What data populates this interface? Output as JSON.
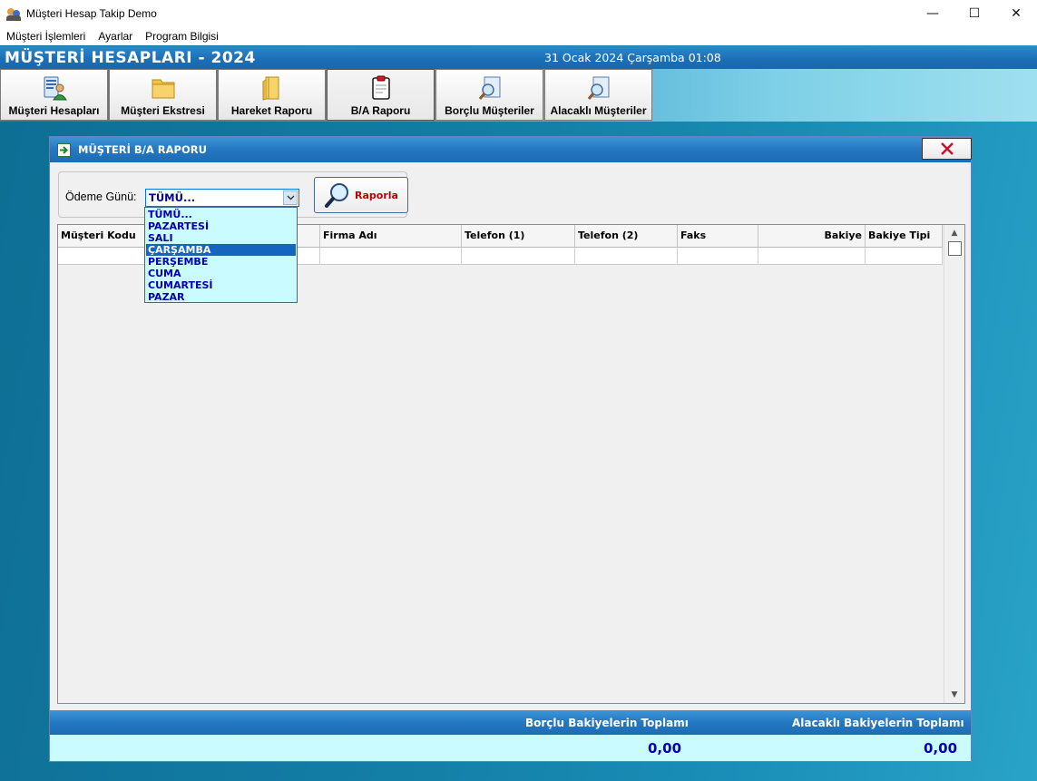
{
  "window": {
    "title": "Müşteri Hesap Takip Demo",
    "minimize_glyph": "—",
    "maximize_glyph": "☐",
    "close_glyph": "✕"
  },
  "menu": {
    "items": [
      "Müşteri İşlemleri",
      "Ayarlar",
      "Program Bilgisi"
    ]
  },
  "header": {
    "title": "MÜŞTERİ HESAPLARI - 2024",
    "date": "31 Ocak 2024 Çarşamba 01:08"
  },
  "toolbar": {
    "buttons": [
      {
        "label": "Müşteri Hesapları",
        "icon": "customer-accounts-icon"
      },
      {
        "label": "Müşteri Ekstresi",
        "icon": "statement-folder-icon"
      },
      {
        "label": "Hareket Raporu",
        "icon": "report-folder-icon"
      },
      {
        "label": "B/A Raporu",
        "icon": "clipboard-icon",
        "active": true
      },
      {
        "label": "Borçlu Müşteriler",
        "icon": "debtor-search-icon"
      },
      {
        "label": "Alacaklı Müşteriler",
        "icon": "creditor-search-icon"
      }
    ]
  },
  "dialog": {
    "title": "MÜŞTERİ B/A RAPORU",
    "close_glyph": "✕",
    "filter": {
      "label": "Ödeme Günü:",
      "selected": "TÜMÜ...",
      "button_label": "Raporla",
      "options": [
        "TÜMÜ...",
        "PAZARTESİ",
        "SALI",
        "ÇARŞAMBA",
        "PERŞEMBE",
        "CUMA",
        "CUMARTESİ",
        "PAZAR"
      ],
      "highlighted_option": "ÇARŞAMBA"
    },
    "grid": {
      "columns": [
        "Müşteri Kodu",
        "",
        "Firma Adı",
        "Telefon (1)",
        "Telefon (2)",
        "Faks",
        "Bakiye",
        "Bakiye Tipi"
      ]
    },
    "totals": {
      "debt_label": "Borçlu Bakiyelerin Toplamı",
      "credit_label": "Alacaklı Bakiyelerin Toplamı",
      "debt_value": "0,00",
      "credit_value": "0,00"
    }
  },
  "colors": {
    "accent_blue": "#1e6cb4",
    "light_cyan": "#c9fbff",
    "value_blue": "#0000b0",
    "raporla_red": "#c00000"
  }
}
